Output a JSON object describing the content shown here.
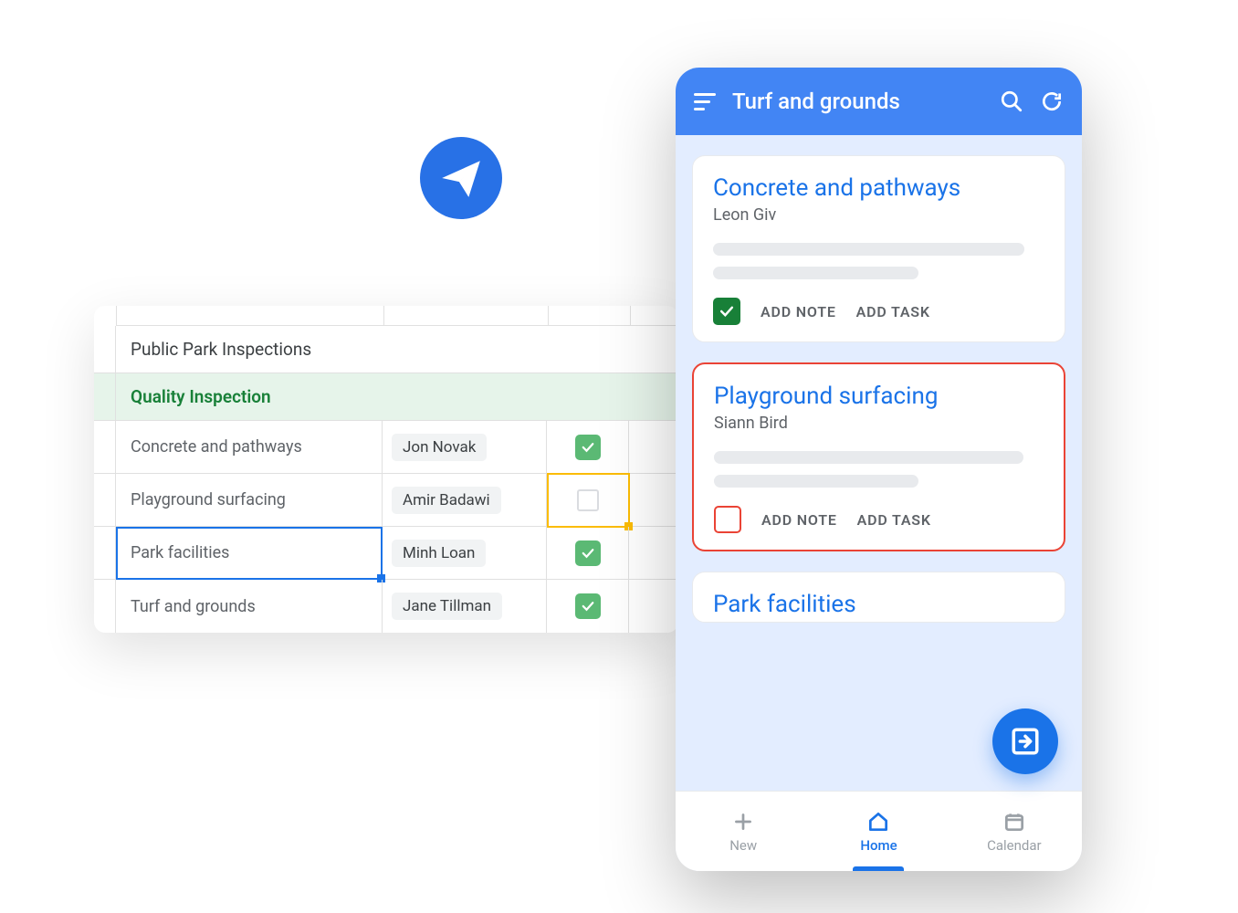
{
  "icon_badge": "paper-plane-icon",
  "spreadsheet": {
    "title": "Public Park Inspections",
    "section_header": "Quality Inspection",
    "rows": [
      {
        "task": "Concrete and pathways",
        "assignee": "Jon Novak",
        "checked": true
      },
      {
        "task": "Playground surfacing",
        "assignee": "Amir Badawi",
        "checked": false
      },
      {
        "task": "Park facilities",
        "assignee": "Minh Loan",
        "checked": true
      },
      {
        "task": "Turf and grounds",
        "assignee": "Jane Tillman",
        "checked": true
      }
    ]
  },
  "mobile": {
    "header_title": "Turf and grounds",
    "cards": [
      {
        "title": "Concrete and pathways",
        "assignee": "Leon Giv",
        "checked": true,
        "highlighted": false
      },
      {
        "title": "Playground surfacing",
        "assignee": "Siann Bird",
        "checked": false,
        "highlighted": true
      },
      {
        "title": "Park facilities",
        "assignee": "",
        "checked": false,
        "highlighted": false
      }
    ],
    "add_note_label": "ADD NOTE",
    "add_task_label": "ADD TASK",
    "nav": {
      "new_label": "New",
      "home_label": "Home",
      "calendar_label": "Calendar"
    }
  }
}
